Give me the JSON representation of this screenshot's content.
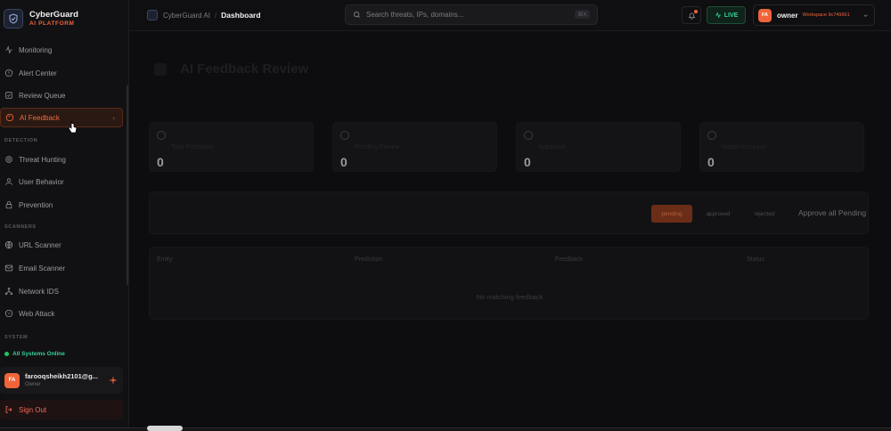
{
  "brand": {
    "name": "CyberGuard",
    "subtitle": "AI PLATFORM"
  },
  "sidebar": {
    "items_top": [
      {
        "label": "Monitoring",
        "icon": "activity-icon"
      },
      {
        "label": "Alert Center",
        "icon": "alert-icon"
      },
      {
        "label": "Review Queue",
        "icon": "review-icon"
      },
      {
        "label": "AI Feedback",
        "icon": "feedback-icon",
        "active": true
      }
    ],
    "sections": [
      {
        "label": "DETECTION",
        "items": [
          "Threat Hunting",
          "User Behavior",
          "Prevention"
        ]
      },
      {
        "label": "SCANNERS",
        "items": [
          "URL Scanner",
          "Email Scanner",
          "Network IDS",
          "Web Attack"
        ]
      },
      {
        "label": "SYSTEM",
        "items": []
      }
    ],
    "status": "All Systems Online",
    "user": {
      "initials": "FA",
      "email": "farooqsheikh2101@g...",
      "role": "Owner"
    },
    "signout": "Sign Out"
  },
  "topbar": {
    "crumb_root": "CyberGuard AI",
    "crumb_sep": "/",
    "crumb_current": "Dashboard",
    "search_placeholder": "Search threats, IPs, domains...",
    "search_kbd": "⌘K",
    "live": "LIVE",
    "account": {
      "initials": "FA",
      "role": "owner",
      "workspace": "Workspace 9c749661"
    }
  },
  "main": {
    "title": "AI Feedback Review",
    "stats": [
      {
        "label": "Total Feedback",
        "value": "0"
      },
      {
        "label": "Pending Review",
        "value": "0"
      },
      {
        "label": "Approved",
        "value": "0"
      },
      {
        "label": "Model Accuracy",
        "value": "0"
      }
    ],
    "filters": {
      "pending": "pending",
      "approved": "approved",
      "rejected": "rejected",
      "approve_all": "Approve all Pending"
    },
    "table": {
      "headers": [
        "Entity",
        "Prediction",
        "Feedback",
        "Status"
      ],
      "empty": "No matching feedback"
    }
  },
  "colors": {
    "accent": "#f0643a",
    "success": "#34d399",
    "background": "#0d0d0f"
  }
}
